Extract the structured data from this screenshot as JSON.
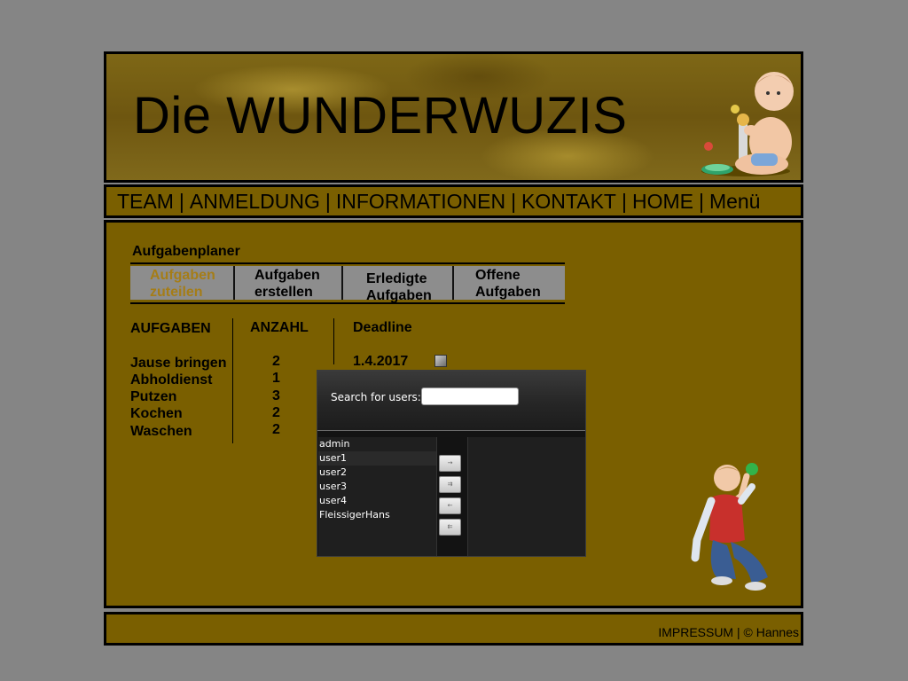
{
  "header": {
    "title": "Die WUNDERWUZIS"
  },
  "nav": {
    "items": [
      "TEAM",
      "ANMELDUNG",
      "INFORMATIONEN",
      "KONTAKT",
      "HOME",
      "Menü"
    ],
    "separator": "|"
  },
  "planner": {
    "title": "Aufgabenplaner",
    "tabs": [
      {
        "line1": "Aufgaben",
        "line2": "zuteilen",
        "active": true
      },
      {
        "line1": "Aufgaben",
        "line2": "erstellen",
        "active": false
      },
      {
        "line1": "Erledigte",
        "line2": "Aufgaben",
        "active": false
      },
      {
        "line1": "Offene",
        "line2": "Aufgaben",
        "active": false
      }
    ],
    "columns": [
      "AUFGABEN",
      "ANZAHL",
      "Deadline"
    ],
    "tasks": [
      {
        "name": "Jause bringen",
        "count": "2"
      },
      {
        "name": "Abholdienst",
        "count": "1"
      },
      {
        "name": "Putzen",
        "count": "3"
      },
      {
        "name": "Kochen",
        "count": "2"
      },
      {
        "name": "Waschen",
        "count": "2"
      }
    ],
    "deadline": "1.4.2017"
  },
  "user_dialog": {
    "search_label": "Search for users:",
    "search_value": "",
    "available_users": [
      "admin",
      "user1",
      "user2",
      "user3",
      "user4",
      "FleissigerHans"
    ],
    "selected_users": [],
    "buttons": [
      "→",
      "⇉",
      "←",
      "⇇"
    ]
  },
  "footer": {
    "impressum": "IMPRESSUM",
    "separator": "|",
    "copyright": "© Hannes"
  },
  "colors": {
    "page_background": "#858585",
    "panel_background": "#7a5f00",
    "active_tab_text": "#a57d17",
    "tab_background": "#8d8d8d",
    "dialog_background": "#131313"
  }
}
